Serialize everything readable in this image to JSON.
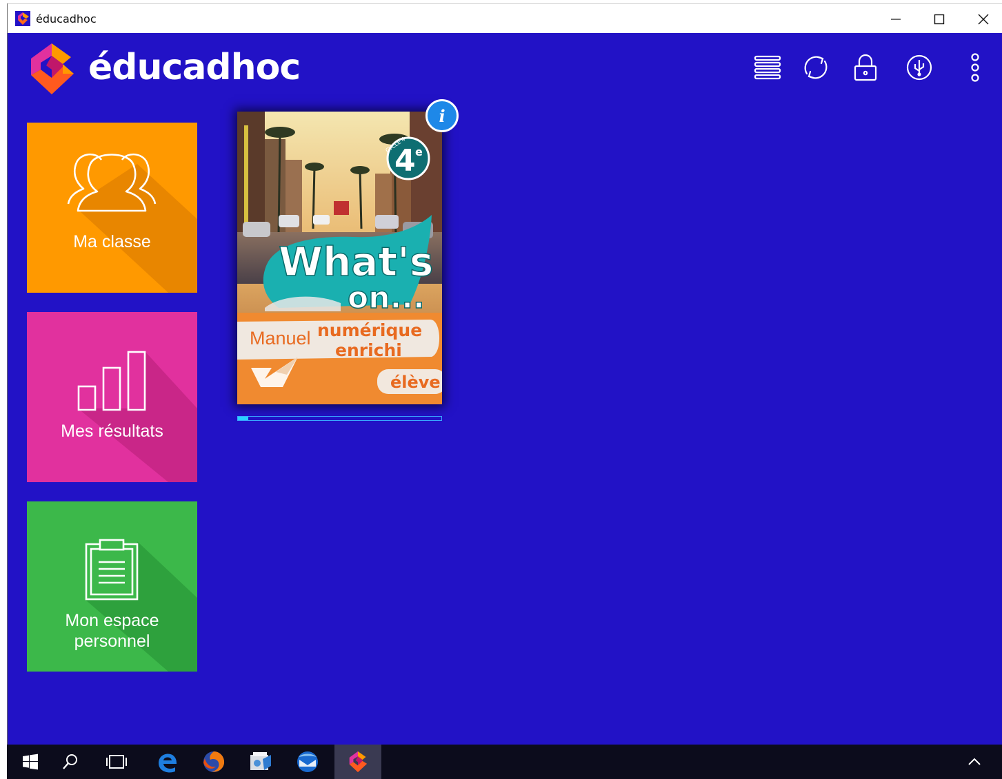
{
  "window": {
    "title": "éducadhoc"
  },
  "header": {
    "logo_text": "éducadhoc",
    "icons": [
      "menu-icon",
      "sync-icon",
      "lock-icon",
      "usb-icon",
      "more-vert-icon"
    ]
  },
  "tiles": [
    {
      "label": "Ma classe",
      "color": "#ff9900",
      "icon": "users-icon"
    },
    {
      "label": "Mes résultats",
      "color": "#e1319e",
      "icon": "bar-chart-icon"
    },
    {
      "label": "Mon espace personnel",
      "label_line1": "Mon espace",
      "label_line2": "personnel",
      "color": "#3cb84a",
      "icon": "clipboard-icon"
    }
  ],
  "book": {
    "title_line1": "What's",
    "title_line2": "on...",
    "grade": "4",
    "grade_suffix": "e",
    "cycle": "CYCLE 4",
    "subtitle_manuel": "Manuel",
    "subtitle_line1": "numérique",
    "subtitle_line2": "enrichi",
    "badge": "élève",
    "info_label": "i",
    "download_progress": 0.05
  },
  "taskbar": {
    "items": [
      "start-icon",
      "search-icon",
      "task-view-icon",
      "edge-icon",
      "firefox-icon",
      "explorer-icon",
      "thunderbird-icon",
      "educadhoc-icon"
    ],
    "active": "educadhoc-icon"
  },
  "colors": {
    "background": "#2212c6",
    "accent_orange": "#ff9900",
    "accent_pink": "#e1319e",
    "accent_green": "#3cb84a"
  }
}
